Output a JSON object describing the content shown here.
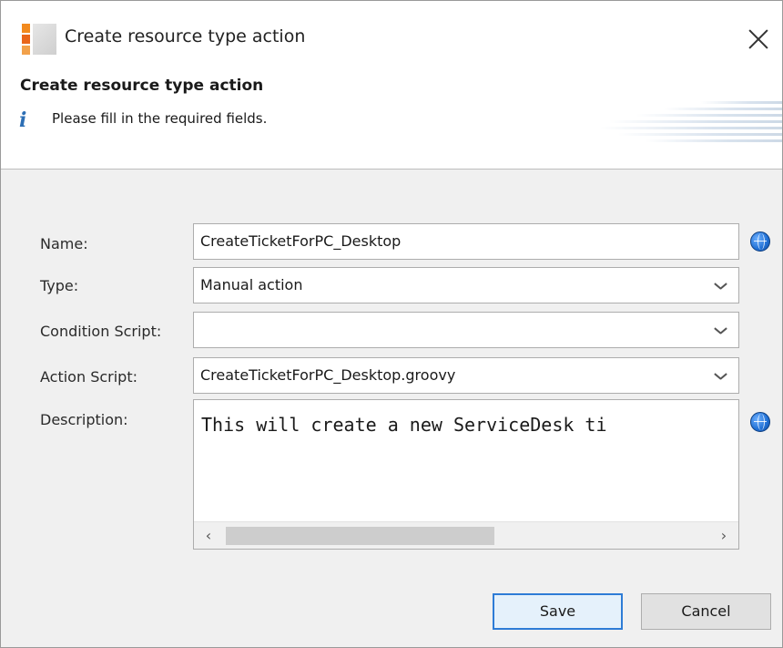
{
  "window": {
    "title": "Create resource type action"
  },
  "header": {
    "heading": "Create resource type action",
    "message": "Please fill in the required fields."
  },
  "form": {
    "name": {
      "label": "Name:",
      "value": "CreateTicketForPC_Desktop"
    },
    "type": {
      "label": "Type:",
      "value": "Manual action"
    },
    "condition_script": {
      "label": "Condition Script:",
      "value": ""
    },
    "action_script": {
      "label": "Action Script:",
      "value": "CreateTicketForPC_Desktop.groovy"
    },
    "description": {
      "label": "Description:",
      "value": "This will create a new ServiceDesk ti"
    }
  },
  "buttons": {
    "save": "Save",
    "cancel": "Cancel"
  },
  "icons": {
    "app": "app-logo-icon",
    "close": "close-icon",
    "info": "info-icon",
    "translate": "globe-icon",
    "dropdown": "chevron-down-icon",
    "scroll_left": "arrow-left-icon",
    "scroll_right": "arrow-right-icon"
  },
  "colors": {
    "accent": "#2e7cd6",
    "globe": "#1f6fd4",
    "info": "#2d6fb5"
  }
}
